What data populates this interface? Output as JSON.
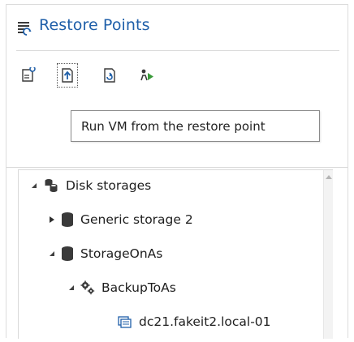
{
  "header": {
    "title": "Restore Points",
    "icon": "restore-points-icon",
    "title_color": "#1f5fa9"
  },
  "toolbar": {
    "buttons": [
      {
        "name": "restore-to-host-button",
        "icon": "restore-config-icon"
      },
      {
        "name": "run-vm-button",
        "icon": "run-vm-icon"
      },
      {
        "name": "instant-restore-button",
        "icon": "restore-file-icon"
      },
      {
        "name": "replicate-button",
        "icon": "run-play-icon"
      }
    ]
  },
  "tooltip": {
    "text": "Run VM from the restore point"
  },
  "tree": {
    "nodes": [
      {
        "label": "Disk storages",
        "expanded": true,
        "icon": "disk-storages-icon"
      },
      {
        "label": "Generic storage 2",
        "expanded": false,
        "icon": "database-icon"
      },
      {
        "label": "StorageOnAs",
        "expanded": true,
        "icon": "database-icon"
      },
      {
        "label": "BackupToAs",
        "expanded": true,
        "icon": "backup-job-gears-icon"
      },
      {
        "label": "dc21.fakeit2.local-01",
        "icon": "vm-restore-point-icon"
      }
    ]
  }
}
